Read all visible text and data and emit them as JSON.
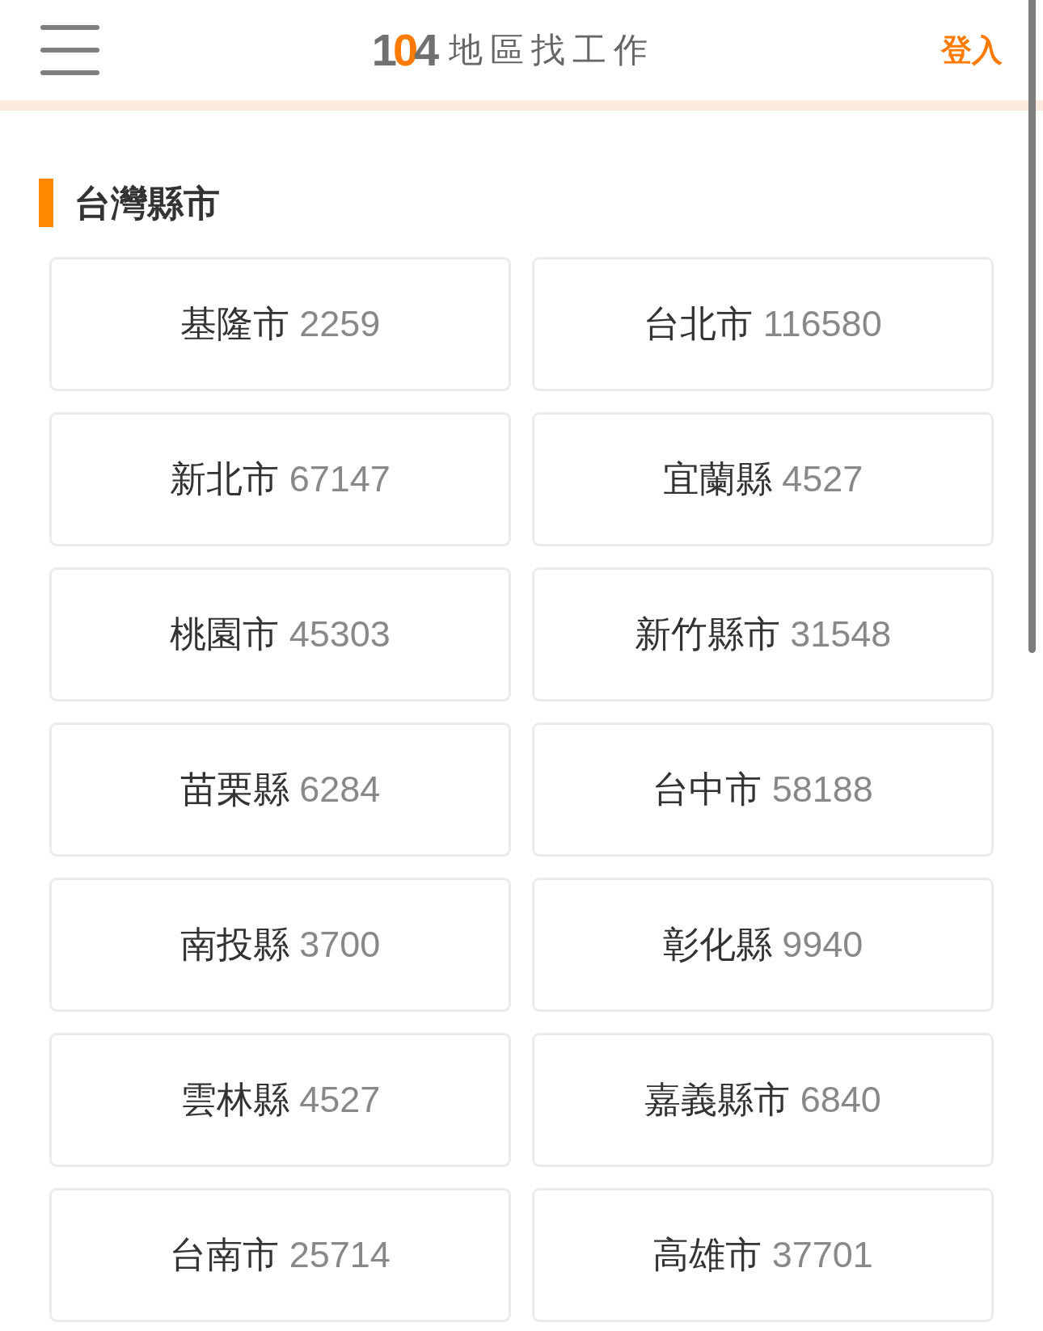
{
  "header": {
    "logo": "104",
    "site_title": "地區找工作",
    "login": "登入"
  },
  "section": {
    "title": "台灣縣市"
  },
  "regions": [
    {
      "name": "基隆市",
      "count": "2259"
    },
    {
      "name": "台北市",
      "count": "116580"
    },
    {
      "name": "新北市",
      "count": "67147"
    },
    {
      "name": "宜蘭縣",
      "count": "4527"
    },
    {
      "name": "桃園市",
      "count": "45303"
    },
    {
      "name": "新竹縣市",
      "count": "31548"
    },
    {
      "name": "苗栗縣",
      "count": "6284"
    },
    {
      "name": "台中市",
      "count": "58188"
    },
    {
      "name": "南投縣",
      "count": "3700"
    },
    {
      "name": "彰化縣",
      "count": "9940"
    },
    {
      "name": "雲林縣",
      "count": "4527"
    },
    {
      "name": "嘉義縣市",
      "count": "6840"
    },
    {
      "name": "台南市",
      "count": "25714"
    },
    {
      "name": "高雄市",
      "count": "37701"
    }
  ]
}
